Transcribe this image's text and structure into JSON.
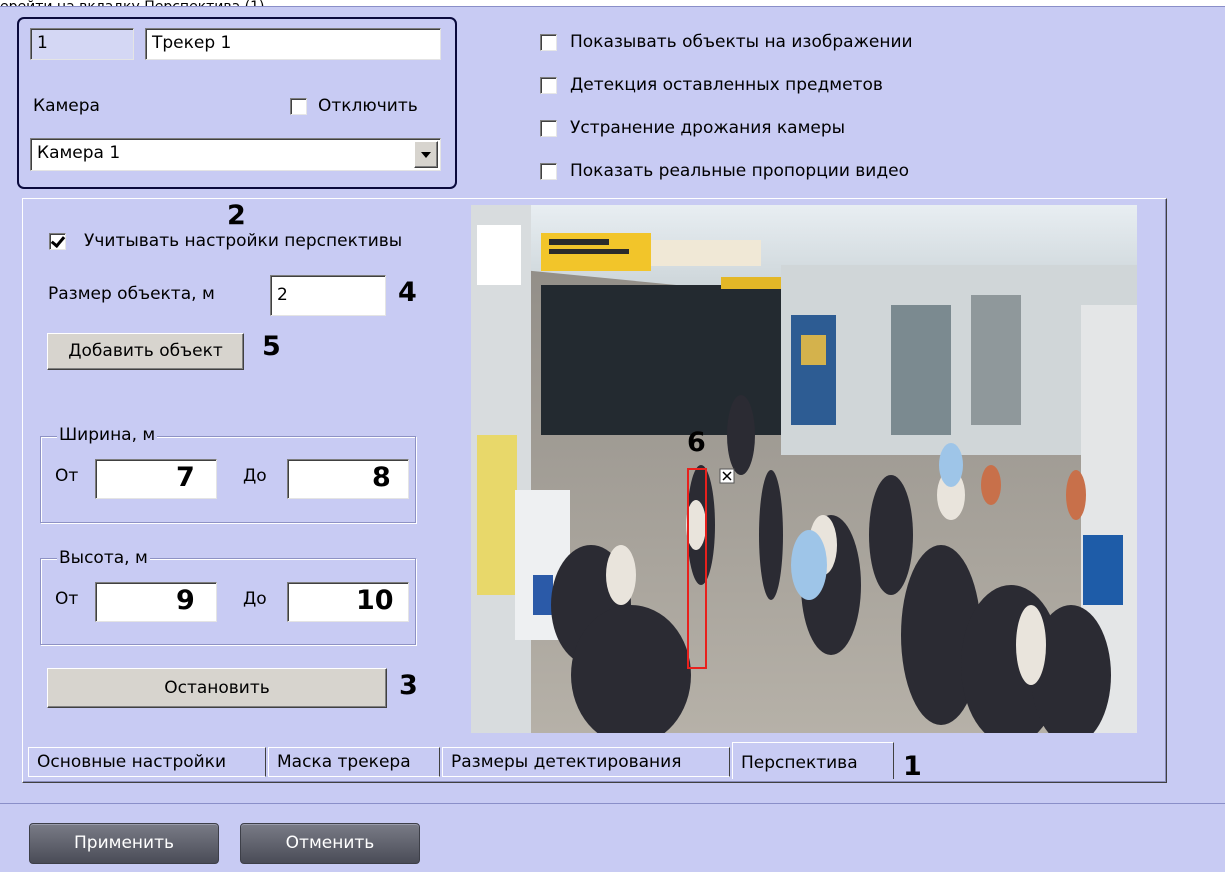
{
  "caption": "ерейти на вкладку Перспектива (1).",
  "tracker": {
    "id": "1",
    "name": "Трекер 1",
    "camera_label": "Камера",
    "disable_label": "Отключить",
    "camera_value": "Камера 1"
  },
  "options": [
    {
      "label": "Показывать объекты на изображении",
      "checked": false
    },
    {
      "label": "Детекция оставленных предметов",
      "checked": false
    },
    {
      "label": "Устранение дрожания камеры",
      "checked": false
    },
    {
      "label": "Показать реальные пропорции видео",
      "checked": false
    }
  ],
  "perspective": {
    "use_label": "Учитывать настройки перспективы",
    "use_checked": true,
    "size_label": "Размер объекта, м",
    "size_value": "2",
    "add_button": "Добавить объект",
    "width_group": "Ширина, м",
    "height_group": "Высота, м",
    "from_label": "От",
    "to_label": "До",
    "width_from": "7",
    "width_to": "8",
    "height_from": "9",
    "height_to": "10",
    "stop_button": "Остановить"
  },
  "callouts": {
    "n1": "1",
    "n2": "2",
    "n3": "3",
    "n4": "4",
    "n5": "5",
    "n6": "6"
  },
  "tabs": [
    "Основные настройки",
    "Маска трекера",
    "Размеры детектирования",
    "Перспектива"
  ],
  "active_tab": 3,
  "footer": {
    "apply": "Применить",
    "cancel": "Отменить"
  },
  "colors": {
    "panel_bg": "#c8cbf3",
    "panel_border": "#0a0a3c",
    "marker_red": "#e8211d"
  }
}
